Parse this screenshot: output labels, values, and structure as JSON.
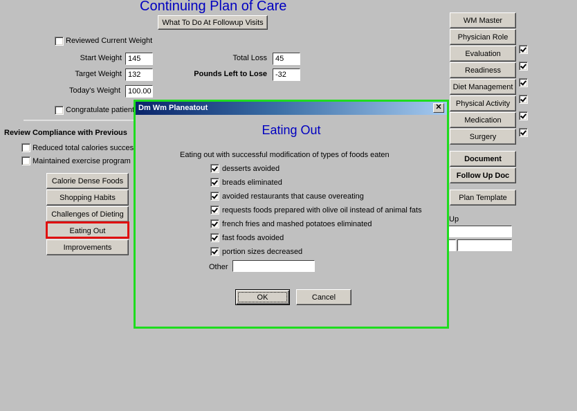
{
  "page": {
    "title": "Continuing Plan of Care",
    "followup_button": "What To Do At Followup Visits",
    "reviewed_weight_label": "Reviewed Current Weight",
    "reviewed_weight_checked": false,
    "start_weight_label": "Start Weight",
    "start_weight": "145",
    "target_weight_label": "Target Weight",
    "target_weight": "132",
    "todays_weight_label": "Today's Weight",
    "todays_weight": "100.00",
    "total_loss_label": "Total Loss",
    "total_loss": "45",
    "pounds_left_label": "Pounds Left to Lose",
    "pounds_left": "-32",
    "congratulate_label": "Congratulate patient",
    "congratulate_checked": false,
    "review_heading": "Review Compliance with Previous",
    "compliance": [
      {
        "label": "Reduced total calories succes",
        "checked": false
      },
      {
        "label": "Maintained exercise program",
        "checked": false
      }
    ],
    "topic_buttons": [
      "Calorie Dense Foods",
      "Shopping Habits",
      "Challenges of Dieting",
      "Eating Out",
      "Improvements"
    ],
    "highlighted_topic": "Eating Out",
    "followup_partial_label": "Up"
  },
  "sidebar": {
    "buttons": [
      {
        "label": "WM Master",
        "checked": null
      },
      {
        "label": "Physician Role",
        "checked": null
      },
      {
        "label": "Evaluation",
        "checked": true
      },
      {
        "label": "Readiness",
        "checked": true
      },
      {
        "label": "Diet Management",
        "checked": true
      },
      {
        "label": "Physical Activity",
        "checked": true
      },
      {
        "label": "Medication",
        "checked": true
      },
      {
        "label": "Surgery",
        "checked": true
      }
    ],
    "document": "Document",
    "follow_up_doc": "Follow Up Doc",
    "plan_template": "Plan Template"
  },
  "dialog": {
    "window_title": "Dm Wm Planeatout",
    "close_glyph": "✕",
    "heading": "Eating Out",
    "prompt": "Eating out with successful modification of types of foods eaten",
    "items": [
      {
        "label": "desserts avoided",
        "checked": true
      },
      {
        "label": "breads eliminated",
        "checked": true
      },
      {
        "label": "avoided restaurants that cause overeating",
        "checked": true
      },
      {
        "label": "requests foods prepared with olive oil instead of animal fats",
        "checked": true
      },
      {
        "label": "french fries and mashed potatoes eliminated",
        "checked": true
      },
      {
        "label": "fast foods avoided",
        "checked": true
      },
      {
        "label": "portion sizes decreased",
        "checked": true
      }
    ],
    "other_label": "Other",
    "other_value": "",
    "ok": "OK",
    "cancel": "Cancel"
  },
  "colors": {
    "title_blue": "#0000c0",
    "highlight_red": "#e01010",
    "dialog_outline_green": "#1edc1e",
    "titlebar_start": "#0a246a",
    "titlebar_end": "#a6caf0"
  }
}
